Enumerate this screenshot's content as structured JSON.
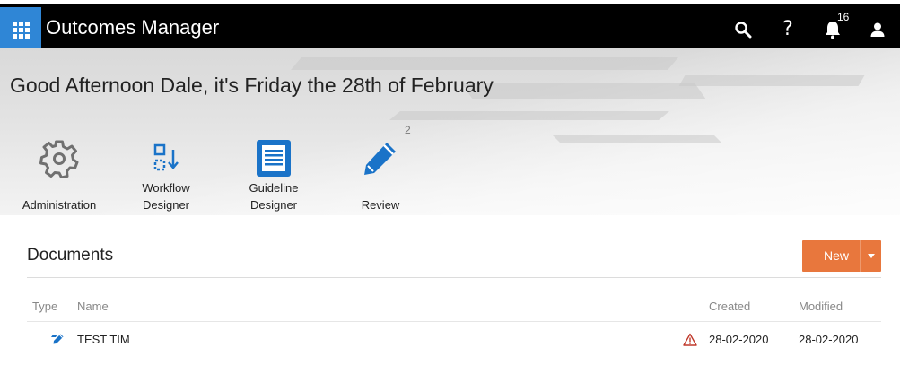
{
  "header": {
    "app_title": "Outcomes Manager",
    "notification_count": "16",
    "icons": [
      "app-launcher-icon",
      "search-icon",
      "help-icon",
      "bell-icon",
      "user-icon"
    ],
    "help_glyph": "?"
  },
  "hero": {
    "greeting": "Good Afternoon Dale, it's Friday the 28th of February",
    "tiles": [
      {
        "label": "Administration",
        "icon": "gear-icon"
      },
      {
        "label": "Workflow\nDesigner",
        "line1": "Workflow",
        "line2": "Designer",
        "icon": "workflow-icon"
      },
      {
        "label": "Guideline\nDesigner",
        "line1": "Guideline",
        "line2": "Designer",
        "icon": "document-icon"
      },
      {
        "label": "Review",
        "icon": "pencil-icon",
        "badge": "2"
      }
    ]
  },
  "documents": {
    "title": "Documents",
    "new_button": "New",
    "columns": {
      "type": "Type",
      "name": "Name",
      "created": "Created",
      "modified": "Modified"
    },
    "rows": [
      {
        "type_icon": "pencil-icon",
        "name": "TEST TIM",
        "warning_icon": "warning-icon",
        "created": "28-02-2020",
        "modified": "28-02-2020"
      }
    ]
  },
  "colors": {
    "topbar": "#000000",
    "launcher": "#2f86d6",
    "accent_blue": "#1a73c8",
    "new_button": "#e8773d",
    "warning": "#c0392b"
  }
}
